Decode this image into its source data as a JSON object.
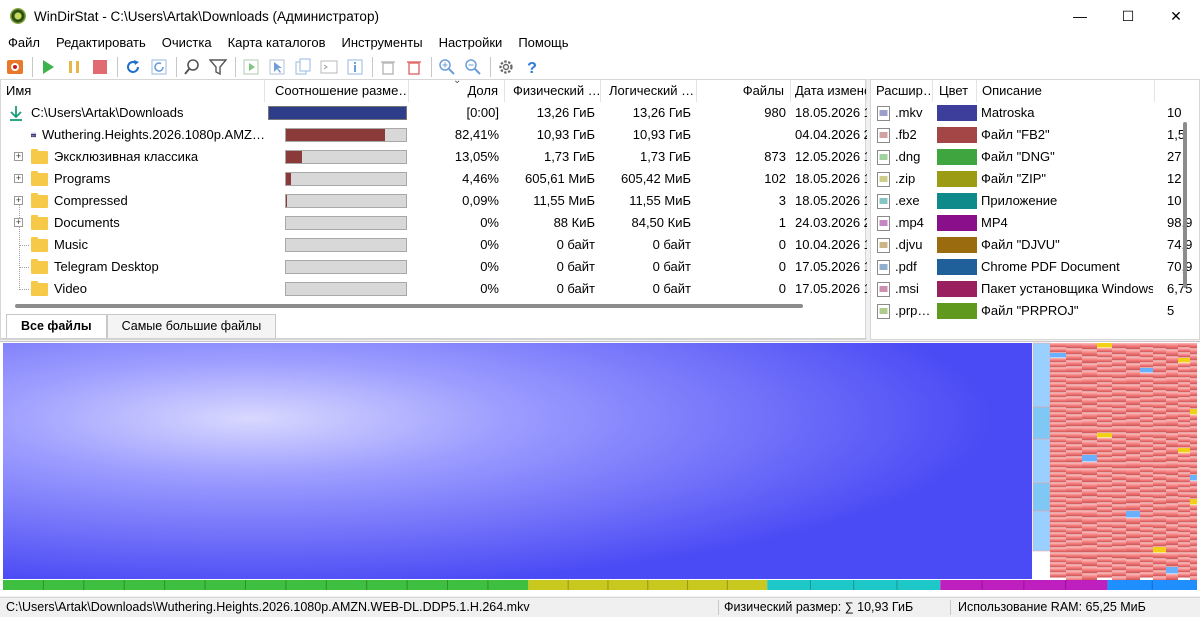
{
  "window": {
    "title": "WinDirStat - C:\\Users\\Artak\\Downloads  (Администратор)",
    "minimize": "—",
    "maximize": "☐",
    "close": "✕"
  },
  "menu": [
    "Файл",
    "Редактировать",
    "Очистка",
    "Карта каталогов",
    "Инструменты",
    "Настройки",
    "Помощь"
  ],
  "toolbar": {
    "buttons": [
      "scan-icon",
      "play-icon",
      "pause-icon",
      "stop-icon",
      "refresh-icon",
      "refresh-selected-icon",
      "search-icon",
      "filter-icon",
      "open-icon",
      "select-icon",
      "copy-path-icon",
      "console-icon",
      "properties-icon",
      "delete-to-bin-icon",
      "delete-icon",
      "zoom-in-icon",
      "zoom-out-icon",
      "settings-icon",
      "help-icon"
    ]
  },
  "tree": {
    "headers": {
      "name": "Имя",
      "ratio": "Соотношение разме…",
      "share": "Доля",
      "physical": "Физический …",
      "logical": "Логический …",
      "files": "Файлы",
      "date": "Дата измене"
    },
    "rows": [
      {
        "name": "C:\\Users\\Artak\\Downloads",
        "ratio": 1.0,
        "share": "[0:00]",
        "physical": "13,26 ГиБ",
        "logical": "13,26 ГиБ",
        "files": "980",
        "date": "18.05.2026 1"
      },
      {
        "name": "Wuthering.Heights.2026.1080p.AMZ…",
        "ratio": 0.8241,
        "share": "82,41%",
        "physical": "10,93 ГиБ",
        "logical": "10,93 ГиБ",
        "files": "",
        "date": "04.04.2026 2"
      },
      {
        "name": "Эксклюзивная классика",
        "ratio": 0.1305,
        "share": "13,05%",
        "physical": "1,73 ГиБ",
        "logical": "1,73 ГиБ",
        "files": "873",
        "date": "12.05.2026 1"
      },
      {
        "name": "Programs",
        "ratio": 0.0446,
        "share": "4,46%",
        "physical": "605,61 МиБ",
        "logical": "605,42 МиБ",
        "files": "102",
        "date": "18.05.2026 1"
      },
      {
        "name": "Compressed",
        "ratio": 0.0009,
        "share": "0,09%",
        "physical": "11,55 МиБ",
        "logical": "11,55 МиБ",
        "files": "3",
        "date": "18.05.2026 1"
      },
      {
        "name": "Documents",
        "ratio": 0,
        "share": "0%",
        "physical": "88 КиБ",
        "logical": "84,50 КиБ",
        "files": "1",
        "date": "24.03.2026 2"
      },
      {
        "name": "Music",
        "ratio": 0,
        "share": "0%",
        "physical": "0 байт",
        "logical": "0 байт",
        "files": "0",
        "date": "10.04.2026 1"
      },
      {
        "name": "Telegram Desktop",
        "ratio": 0,
        "share": "0%",
        "physical": "0 байт",
        "logical": "0 байт",
        "files": "0",
        "date": "17.05.2026 1"
      },
      {
        "name": "Video",
        "ratio": 0,
        "share": "0%",
        "physical": "0 байт",
        "logical": "0 байт",
        "files": "0",
        "date": "17.05.2026 1"
      }
    ]
  },
  "tabs": [
    "Все файлы",
    "Самые большие файлы"
  ],
  "extensions": {
    "headers": {
      "ext": "Расшир…",
      "color": "Цвет",
      "desc": "Описание",
      "more": ""
    },
    "rows": [
      {
        "ext": ".mkv",
        "color": "#3d3d9c",
        "desc": "Matroska",
        "size": "10",
        "icon": "mkv-icon"
      },
      {
        "ext": ".fb2",
        "color": "#a54646",
        "desc": "Файл \"FB2\"",
        "size": "1,5",
        "icon": "file-icon"
      },
      {
        "ext": ".dng",
        "color": "#3fa63f",
        "desc": "Файл \"DNG\"",
        "size": "27",
        "icon": "image-icon"
      },
      {
        "ext": ".zip",
        "color": "#9c9c14",
        "desc": "Файл \"ZIP\"",
        "size": "12",
        "icon": "archive-icon"
      },
      {
        "ext": ".exe",
        "color": "#0f8a8a",
        "desc": "Приложение",
        "size": "10",
        "icon": "exe-icon"
      },
      {
        "ext": ".mp4",
        "color": "#8a0f8a",
        "desc": "MP4",
        "size": "98,9",
        "icon": "video-icon"
      },
      {
        "ext": ".djvu",
        "color": "#9a6b0f",
        "desc": "Файл \"DJVU\"",
        "size": "74,9",
        "icon": "file-icon"
      },
      {
        "ext": ".pdf",
        "color": "#1f5f9a",
        "desc": "Chrome PDF Document",
        "size": "70,9",
        "icon": "chrome-icon"
      },
      {
        "ext": ".msi",
        "color": "#9a1f5f",
        "desc": "Пакет установщика Windows",
        "size": "6,75",
        "icon": "msi-icon"
      },
      {
        "ext": ".prp…",
        "color": "#5f9a1f",
        "desc": "Файл \"PRPROJ\"",
        "size": "5",
        "icon": "file-icon"
      }
    ]
  },
  "treemap": {
    "main_color": "#6b6bff",
    "bottom_strip": [
      {
        "color": "#3fbf3f",
        "share": 0.44
      },
      {
        "color": "#c8c81f",
        "share": 0.2
      },
      {
        "color": "#1fc8c8",
        "share": 0.145
      },
      {
        "color": "#bf1fbf",
        "share": 0.14
      },
      {
        "color": "#1f8fff",
        "share": 0.075
      }
    ]
  },
  "status": {
    "path": "C:\\Users\\Artak\\Downloads\\Wuthering.Heights.2026.1080p.AMZN.WEB-DL.DDP5.1.H.264.mkv",
    "physical": "Физический размер: ∑ 10,93 ГиБ",
    "ram": "Использование RAM: 65,25 МиБ"
  }
}
